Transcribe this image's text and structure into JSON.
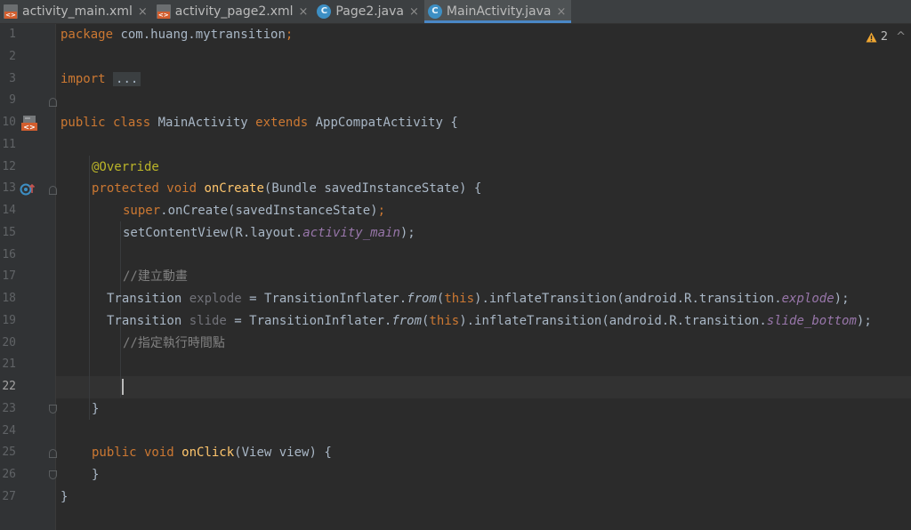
{
  "tabs": [
    {
      "label": "activity_main.xml",
      "icon": "xml-file-icon",
      "close": "×"
    },
    {
      "label": "activity_page2.xml",
      "icon": "xml-file-icon",
      "close": "×"
    },
    {
      "label": "Page2.java",
      "icon": "java-class-icon",
      "icon_letter": "C",
      "close": "×"
    },
    {
      "label": "MainActivity.java",
      "icon": "java-class-icon",
      "icon_letter": "C",
      "close": "×",
      "active": true
    }
  ],
  "warnings": {
    "count": "2",
    "icon": "warning-triangle-icon",
    "chevron": "^"
  },
  "line_numbers": [
    "1",
    "2",
    "3",
    "9",
    "10",
    "11",
    "12",
    "13",
    "14",
    "15",
    "16",
    "17",
    "18",
    "19",
    "20",
    "21",
    "22",
    "23",
    "24",
    "25",
    "26",
    "27"
  ],
  "code": {
    "l1": {
      "kw": "package",
      "rest": " com.huang.mytransition",
      "semi": ";"
    },
    "l3": {
      "kw": "import",
      "dots": "..."
    },
    "l10": {
      "kw1": "public class",
      "name": " MainActivity ",
      "kw2": "extends",
      "rest": " AppCompatActivity {"
    },
    "l12": {
      "annotation": "@Override"
    },
    "l13": {
      "kw": "protected void",
      "fn": "onCreate",
      "rest": "(Bundle savedInstanceState) {"
    },
    "l14": {
      "kw": "super",
      "rest": ".onCreate(savedInstanceState)",
      "semi": ";"
    },
    "l15": {
      "pre": "setContentView(R.layout.",
      "field": "activity_main",
      "post": ");"
    },
    "l17": {
      "comment": "//建立動畫"
    },
    "l18": {
      "type": "Transition ",
      "var": "explode",
      "mid": " = TransitionInflater.",
      "from": "from",
      "p1": "(",
      "this": "this",
      "p2": ").inflateTransition(android.R.transition.",
      "field": "explode",
      "end": ");"
    },
    "l19": {
      "type": "Transition ",
      "var": "slide",
      "mid": " = TransitionInflater.",
      "from": "from",
      "p1": "(",
      "this": "this",
      "p2": ").inflateTransition(android.R.transition.",
      "field": "slide_bottom",
      "end": ");"
    },
    "l20": {
      "comment": "//指定執行時間點"
    },
    "l23": {
      "brace": "}"
    },
    "l25": {
      "kw": "public void",
      "fn": "onClick",
      "rest": "(View view) {"
    },
    "l26": {
      "brace": "}"
    },
    "l27": {
      "brace": "}"
    }
  },
  "gutter_icons": {
    "l10": "android-activity-icon",
    "l13": "override-method-icon"
  },
  "colors": {
    "background": "#2b2b2b",
    "keyword": "#cc7832",
    "function": "#ffc66d",
    "annotation": "#bbb529",
    "field": "#9876aa",
    "comment": "#808080",
    "text": "#a9b7c6",
    "tab_accent": "#4a88c7"
  }
}
